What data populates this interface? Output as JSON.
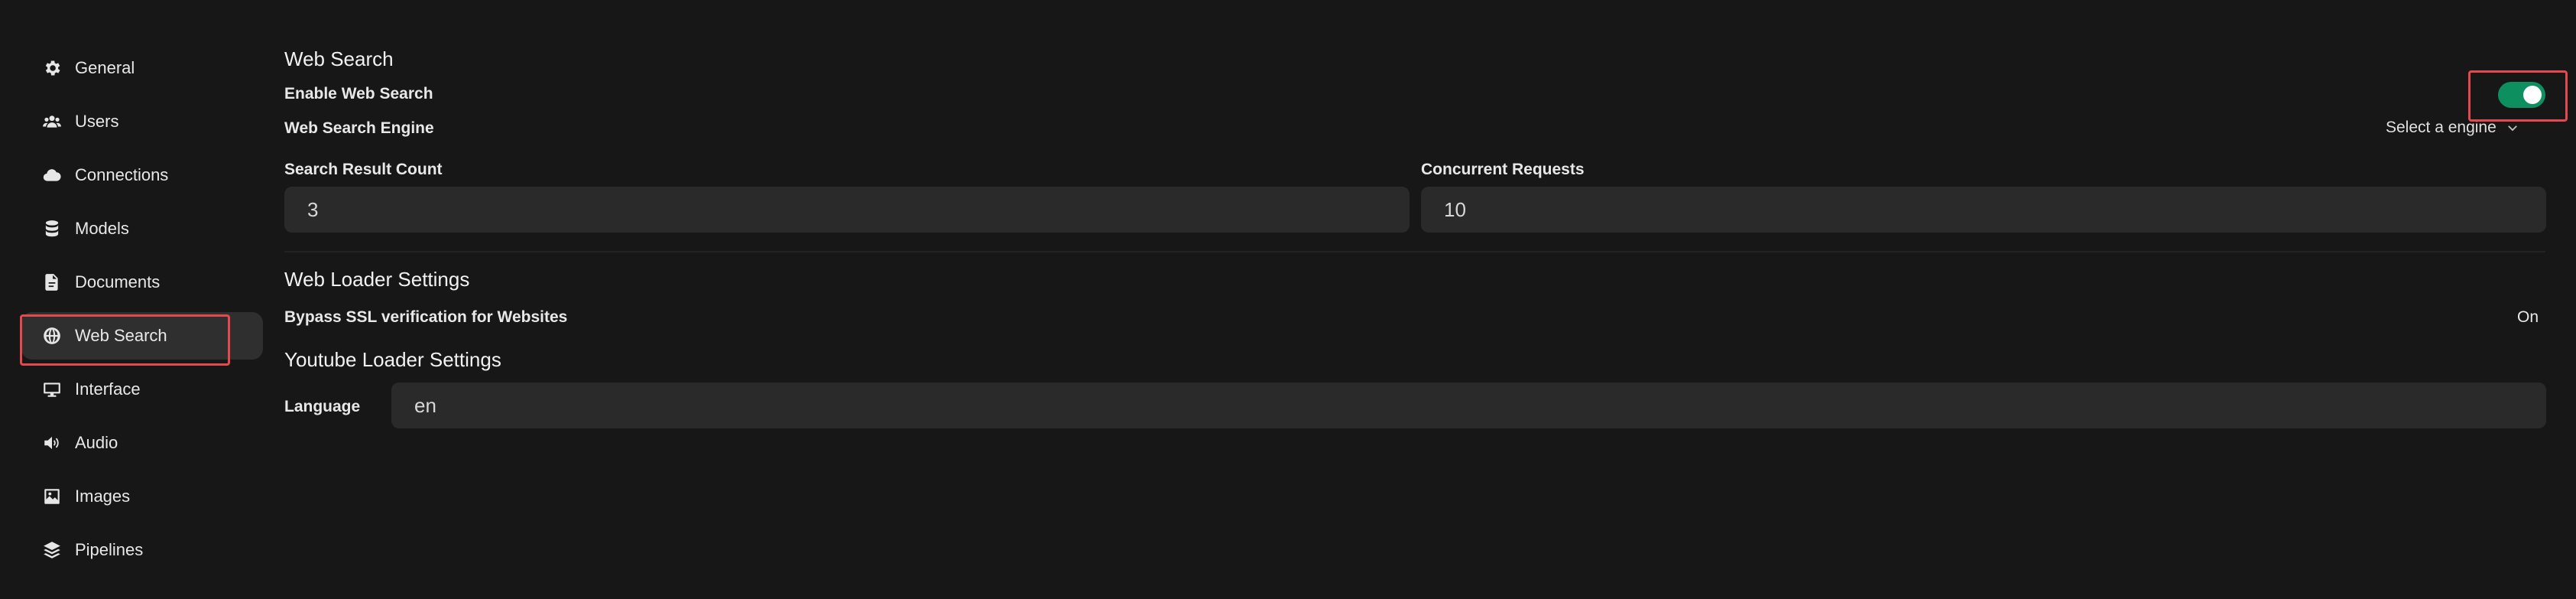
{
  "sidebar": {
    "items": [
      {
        "label": "General",
        "icon": "gear-icon"
      },
      {
        "label": "Users",
        "icon": "users-icon"
      },
      {
        "label": "Connections",
        "icon": "cloud-icon"
      },
      {
        "label": "Models",
        "icon": "database-icon"
      },
      {
        "label": "Documents",
        "icon": "document-icon"
      },
      {
        "label": "Web Search",
        "icon": "globe-icon",
        "active": true
      },
      {
        "label": "Interface",
        "icon": "monitor-icon"
      },
      {
        "label": "Audio",
        "icon": "speaker-icon"
      },
      {
        "label": "Images",
        "icon": "image-icon"
      },
      {
        "label": "Pipelines",
        "icon": "layers-icon"
      }
    ]
  },
  "web_search": {
    "title": "Web Search",
    "enable_label": "Enable Web Search",
    "enabled": true,
    "engine_label": "Web Search Engine",
    "engine_value": "Select a engine",
    "result_count_label": "Search Result Count",
    "result_count_value": "3",
    "concurrent_label": "Concurrent Requests",
    "concurrent_value": "10"
  },
  "web_loader": {
    "title": "Web Loader Settings",
    "bypass_ssl_label": "Bypass SSL verification for Websites",
    "bypass_ssl_value": "On"
  },
  "youtube_loader": {
    "title": "Youtube Loader Settings",
    "language_label": "Language",
    "language_value": "en"
  },
  "colors": {
    "background": "#171717",
    "toggle_on": "#0d8f5f",
    "highlight": "#e5484d",
    "input_bg": "#2a2a2a"
  }
}
